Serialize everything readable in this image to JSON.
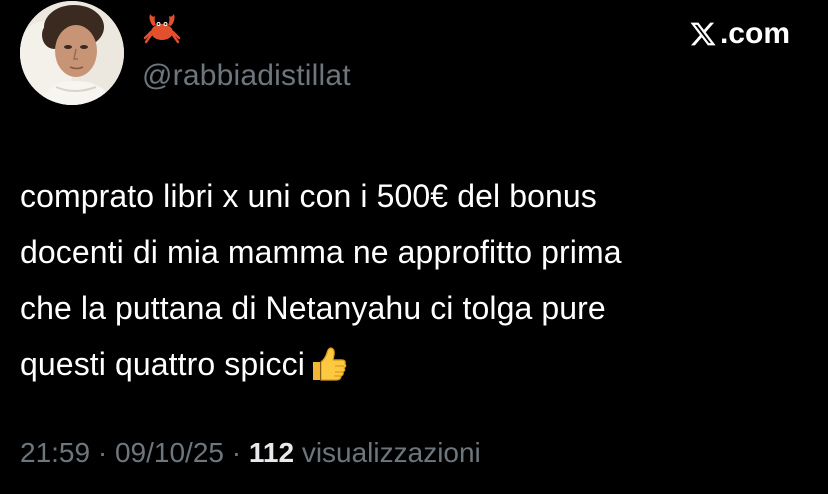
{
  "profile": {
    "display_name_icon": "crab-emoji",
    "handle": "@rabbiadistillat"
  },
  "brand": {
    "label": ".com",
    "icon": "x-logo-icon"
  },
  "tweet": {
    "lines": [
      "comprato libri x uni con i 500€ del bonus",
      "docenti di mia mamma ne approfitto prima",
      "che la puttana di Netanyahu ci tolga pure",
      "questi quattro spicci"
    ],
    "emoji_icon": "thumbs-up-emoji"
  },
  "meta": {
    "time": "21:59",
    "date": "09/10/25",
    "separator": "·",
    "views_count": "112",
    "views_label": "visualizzazioni"
  },
  "colors": {
    "background": "#000000",
    "text": "#ffffff",
    "muted": "#6e767d"
  }
}
